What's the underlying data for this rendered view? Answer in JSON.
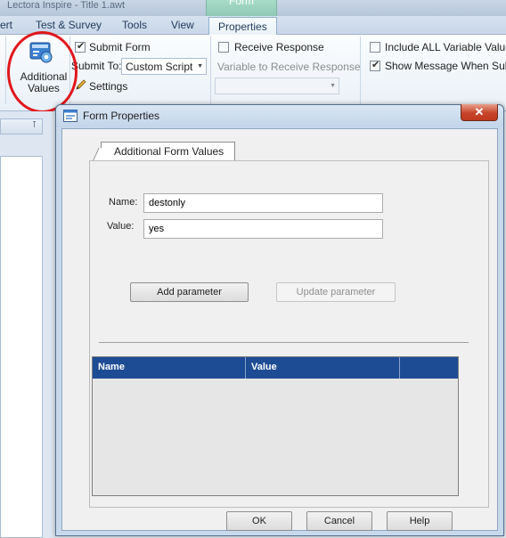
{
  "app": {
    "title": "Lectora Inspire - Title 1.awt",
    "context_tab_header": "Form"
  },
  "ribbon": {
    "tabs": [
      "ert",
      "Test & Survey",
      "Tools",
      "View",
      "Properties"
    ],
    "active_tab": "Properties",
    "additional_values_label": "Additional Values",
    "submit_form_label": "Submit Form",
    "submit_form_checked": true,
    "submit_to_label": "Submit To:",
    "submit_to_value": "Custom Script",
    "settings_label": "Settings",
    "receive_response_label": "Receive Response",
    "receive_response_checked": false,
    "variable_to_receive_label": "Variable to Receive Response",
    "include_all_label": "Include ALL Variable Value",
    "include_all_checked": false,
    "show_message_label": "Show Message When Subm",
    "show_message_checked": true
  },
  "dialog": {
    "title": "Form Properties",
    "close_glyph": "✕",
    "tab_label": "Additional Form Values",
    "name_label": "Name:",
    "name_value": "destonly",
    "value_label": "Value:",
    "value_value": "yes",
    "add_button": "Add parameter",
    "update_button": "Update parameter",
    "grid_columns": [
      "Name",
      "Value"
    ],
    "grid_rows": [],
    "ok_button": "OK",
    "cancel_button": "Cancel",
    "help_button": "Help"
  },
  "colors": {
    "grid_header": "#1e4c94",
    "highlight_circle": "#e1171c"
  }
}
